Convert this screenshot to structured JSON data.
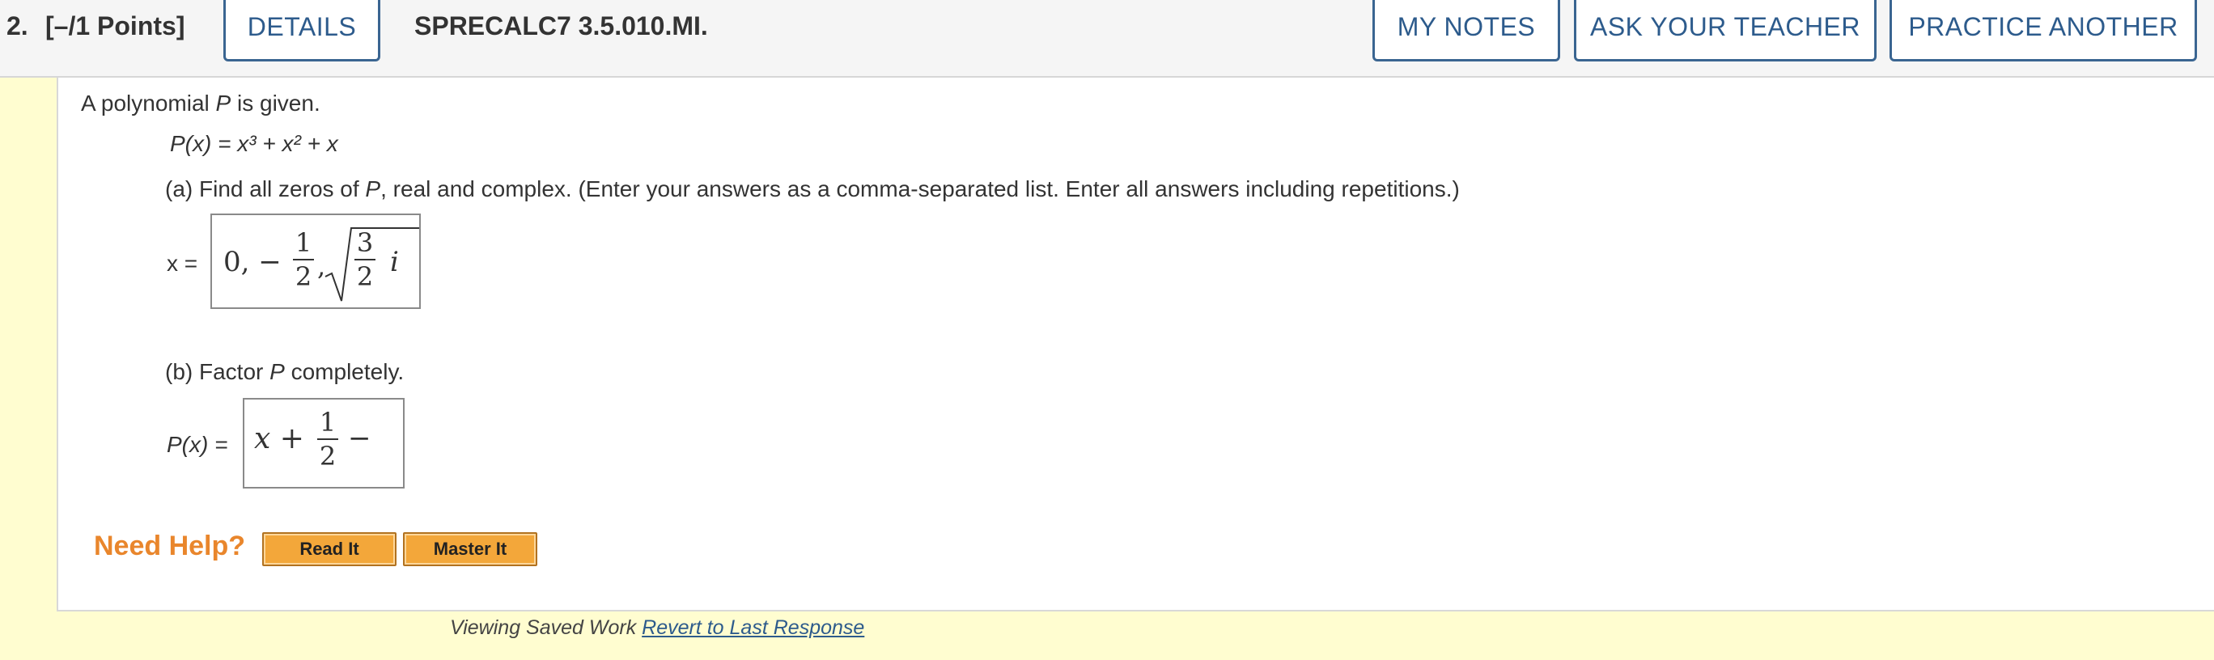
{
  "header": {
    "question_number": "2.",
    "points": "[–/1 Points]",
    "details_label": "DETAILS",
    "assignment_code": "SPRECALC7 3.5.010.MI.",
    "my_notes_label": "MY NOTES",
    "ask_teacher_label": "ASK YOUR TEACHER",
    "practice_another_label": "PRACTICE ANOTHER"
  },
  "question": {
    "intro_prefix": "A polynomial ",
    "intro_var": "P",
    "intro_suffix": " is given.",
    "poly_lhs": "P(x)",
    "poly_rhs": "= x³ + x² + x",
    "part_a_prefix": "(a) Find all zeros of ",
    "part_a_var": "P",
    "part_a_suffix": ", real and complex. (Enter your answers as a comma-separated list. Enter all answers including repetitions.)",
    "part_a_label": "x =",
    "part_a_answer": {
      "lead": "0, −",
      "frac1_num": "1",
      "frac1_den": "2",
      "comma": ",",
      "frac2_num": "3",
      "frac2_den": "2",
      "imag": "i"
    },
    "part_b_prefix": "(b) Factor ",
    "part_b_var": "P",
    "part_b_suffix": " completely.",
    "part_b_label": "P(x) =",
    "part_b_answer": {
      "lead": "x +",
      "frac_num": "1",
      "frac_den": "2",
      "trail": "−"
    }
  },
  "help": {
    "need_help": "Need Help?",
    "read_it": "Read It",
    "master_it": "Master It"
  },
  "footer": {
    "viewing_text": "Viewing Saved Work",
    "revert_link": "Revert to Last Response"
  }
}
